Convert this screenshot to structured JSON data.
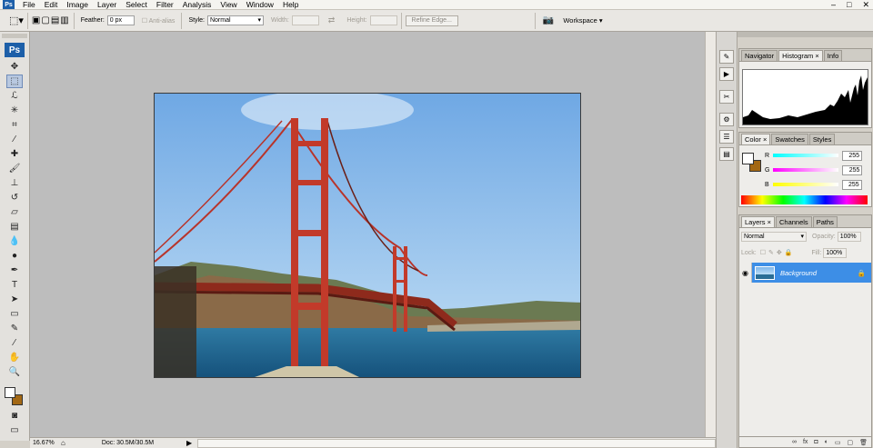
{
  "menu": {
    "app_icon": "Ps",
    "items": [
      "File",
      "Edit",
      "Image",
      "Layer",
      "Select",
      "Filter",
      "Analysis",
      "View",
      "Window",
      "Help"
    ],
    "window_controls": [
      "–",
      "□",
      "✕"
    ]
  },
  "options": {
    "feather_label": "Feather:",
    "feather_value": "0 px",
    "antialias_label": "Anti-alias",
    "style_label": "Style:",
    "style_value": "Normal",
    "width_label": "Width:",
    "height_label": "Height:",
    "refine_label": "Refine Edge...",
    "workspace_label": "Workspace ▾"
  },
  "toolbox": {
    "logo": "Ps",
    "tools": [
      {
        "name": "move-tool-icon",
        "glyph": "✥"
      },
      {
        "name": "marquee-tool-icon",
        "glyph": "⬚",
        "selected": true
      },
      {
        "name": "lasso-tool-icon",
        "glyph": "ℒ"
      },
      {
        "name": "magic-wand-tool-icon",
        "glyph": "✳"
      },
      {
        "name": "crop-tool-icon",
        "glyph": "⌗"
      },
      {
        "name": "slice-tool-icon",
        "glyph": "∕"
      },
      {
        "name": "healing-brush-tool-icon",
        "glyph": "✚"
      },
      {
        "name": "brush-tool-icon",
        "glyph": "🖌"
      },
      {
        "name": "clone-stamp-tool-icon",
        "glyph": "⊥"
      },
      {
        "name": "history-brush-tool-icon",
        "glyph": "↺"
      },
      {
        "name": "eraser-tool-icon",
        "glyph": "▱"
      },
      {
        "name": "gradient-tool-icon",
        "glyph": "▤"
      },
      {
        "name": "blur-tool-icon",
        "glyph": "💧"
      },
      {
        "name": "dodge-tool-icon",
        "glyph": "●"
      },
      {
        "name": "pen-tool-icon",
        "glyph": "✒"
      },
      {
        "name": "type-tool-icon",
        "glyph": "T"
      },
      {
        "name": "path-selection-tool-icon",
        "glyph": "➤"
      },
      {
        "name": "shape-tool-icon",
        "glyph": "▭"
      },
      {
        "name": "notes-tool-icon",
        "glyph": "✎"
      },
      {
        "name": "eyedropper-tool-icon",
        "glyph": "⁄"
      },
      {
        "name": "hand-tool-icon",
        "glyph": "✋"
      },
      {
        "name": "zoom-tool-icon",
        "glyph": "🔍"
      }
    ]
  },
  "status": {
    "zoom": "16.67%",
    "doc": "Doc: 30.5M/30.5M"
  },
  "navigator_panel": {
    "tabs": [
      "Navigator",
      "Histogram ×",
      "Info"
    ]
  },
  "color_panel": {
    "tabs": [
      "Color ×",
      "Swatches",
      "Styles"
    ],
    "channels": [
      {
        "label": "R",
        "value": "255",
        "color": "#e03030"
      },
      {
        "label": "G",
        "value": "255",
        "color": "#d040d0"
      },
      {
        "label": "B",
        "value": "255",
        "color": "#e0e030"
      }
    ],
    "foreground": "#ffffff",
    "background": "#a36814"
  },
  "layers_panel": {
    "tabs": [
      "Layers ×",
      "Channels",
      "Paths"
    ],
    "blend_mode": "Normal",
    "opacity_label": "Opacity:",
    "opacity_value": "100%",
    "lock_label": "Lock:",
    "fill_label": "Fill:",
    "fill_value": "100%",
    "layer_name": "Background"
  }
}
